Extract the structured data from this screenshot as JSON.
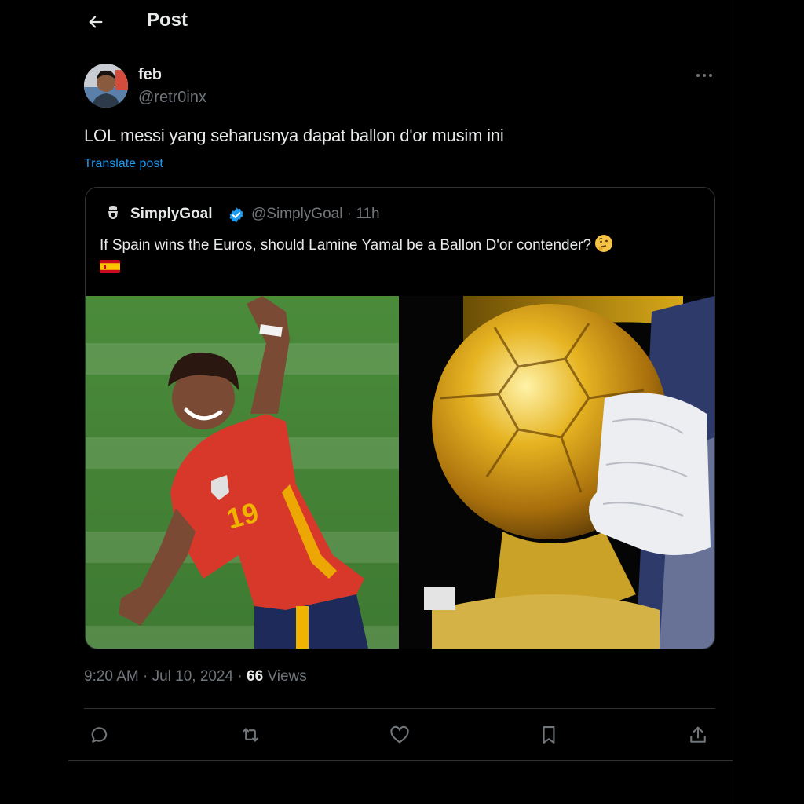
{
  "header": {
    "title": "Post"
  },
  "post": {
    "author_name": "feb",
    "author_handle": "@retr0inx",
    "text": "LOL messi yang seharusnya dapat ballon d'or musim ini",
    "translate_label": "Translate post",
    "timestamp": "9:20 AM · Jul 10, 2024 · ",
    "views_count": "66",
    "views_label": "Views"
  },
  "quote": {
    "author_name": "SimplyGoal",
    "author_handle": "@SimplyGoal · 11h",
    "text": "If Spain wins the Euros, should Lamine Yamal be a Ballon D'or contender?",
    "emoji": "thinking-face",
    "flag": "spain-flag"
  },
  "actions": [
    "reply-icon",
    "retweet-icon",
    "like-icon",
    "bookmark-icon",
    "share-icon"
  ],
  "colors": {
    "accent": "#1d9bf0",
    "text": "#e7e9ea",
    "muted": "#71767b",
    "border": "#2f3336",
    "background": "#000000"
  }
}
